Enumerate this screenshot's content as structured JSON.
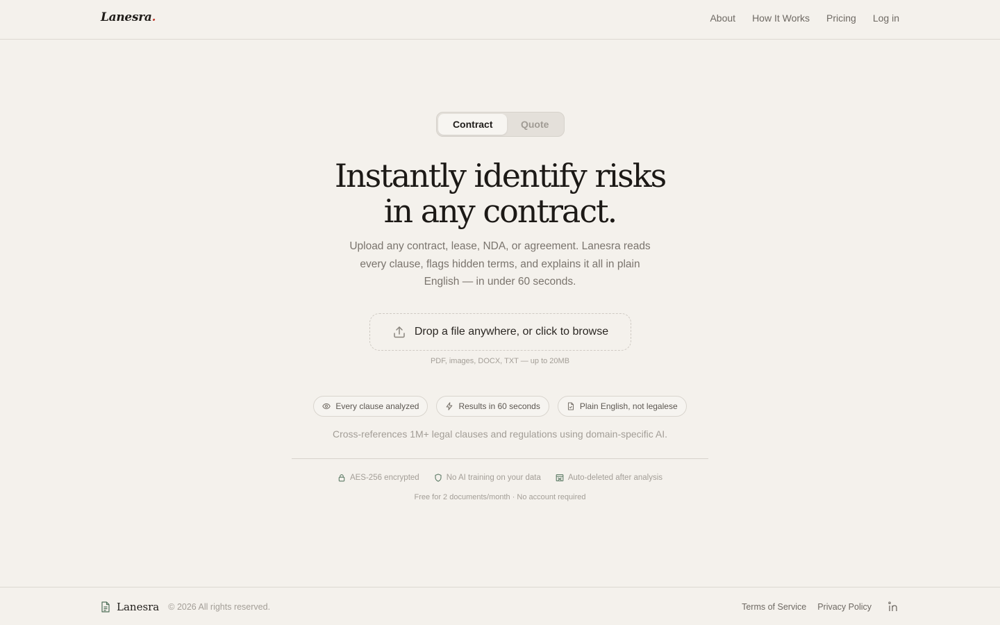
{
  "brand": {
    "name": "Lanesra",
    "dot": ".",
    "accent_color": "#c0392b"
  },
  "nav": {
    "items": [
      {
        "label": "About"
      },
      {
        "label": "How It Works"
      },
      {
        "label": "Pricing"
      },
      {
        "label": "Log in"
      }
    ]
  },
  "mode_toggle": {
    "options": [
      {
        "label": "Contract",
        "selected": true
      },
      {
        "label": "Quote",
        "selected": false
      }
    ]
  },
  "hero": {
    "headline_line1": "Instantly identify risks",
    "headline_line2": "in any contract.",
    "subtext": "Upload any contract, lease, NDA, or agreement. Lanesra reads every clause, flags hidden terms, and explains it all in plain English — in under 60 seconds."
  },
  "dropzone": {
    "icon": "upload-icon",
    "label": "Drop a file anywhere, or click to browse",
    "hint": "PDF, images, DOCX, TXT — up to 20MB"
  },
  "features": [
    {
      "icon": "eye-icon",
      "label": "Every clause analyzed"
    },
    {
      "icon": "lightning-icon",
      "label": "Results in 60 seconds"
    },
    {
      "icon": "document-check-icon",
      "label": "Plain English, not legalese"
    }
  ],
  "crossref": "Cross-references 1M+ legal clauses and regulations using domain-specific AI.",
  "trust": [
    {
      "icon": "lock-icon",
      "label": "AES-256 encrypted"
    },
    {
      "icon": "shield-icon",
      "label": "No AI training on your data"
    },
    {
      "icon": "auto-delete-icon",
      "label": "Auto-deleted after analysis"
    }
  ],
  "free_note": "Free for 2 documents/month · No account required",
  "footer": {
    "brand": "Lanesra",
    "copyright": "© 2026 All rights reserved.",
    "links": [
      {
        "label": "Terms of Service"
      },
      {
        "label": "Privacy Policy"
      }
    ],
    "social_icon": "linkedin-icon"
  },
  "colors": {
    "background": "#f4f1ec",
    "trust_icon": "#5b7a64"
  }
}
